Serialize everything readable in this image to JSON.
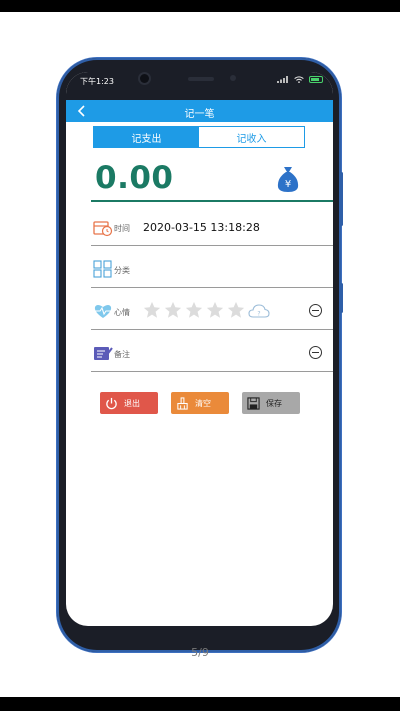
{
  "status_bar": {
    "time": "下午1:23"
  },
  "app_bar": {
    "title": "记一笔"
  },
  "tabs": [
    {
      "label": "记支出",
      "active": true
    },
    {
      "label": "记收入",
      "active": false
    }
  ],
  "amount": {
    "value": "0.00",
    "icon": "money-bag-icon"
  },
  "rows": {
    "time": {
      "label": "时间",
      "value": "2020-03-15 13:18:28"
    },
    "category": {
      "label": "分类"
    },
    "mood": {
      "label": "心情",
      "rating": 0,
      "max": 5,
      "extra_icon": "cloud-question-icon"
    },
    "note": {
      "label": "备注"
    }
  },
  "buttons": {
    "exit": "退出",
    "clear": "清空",
    "save": "保存"
  },
  "page_indicator": "5/9",
  "colors": {
    "primary": "#1e9be6",
    "amount": "#1b7a64",
    "exit": "#e0574a",
    "clear": "#ea8a3a",
    "save": "#a8a8a8"
  }
}
